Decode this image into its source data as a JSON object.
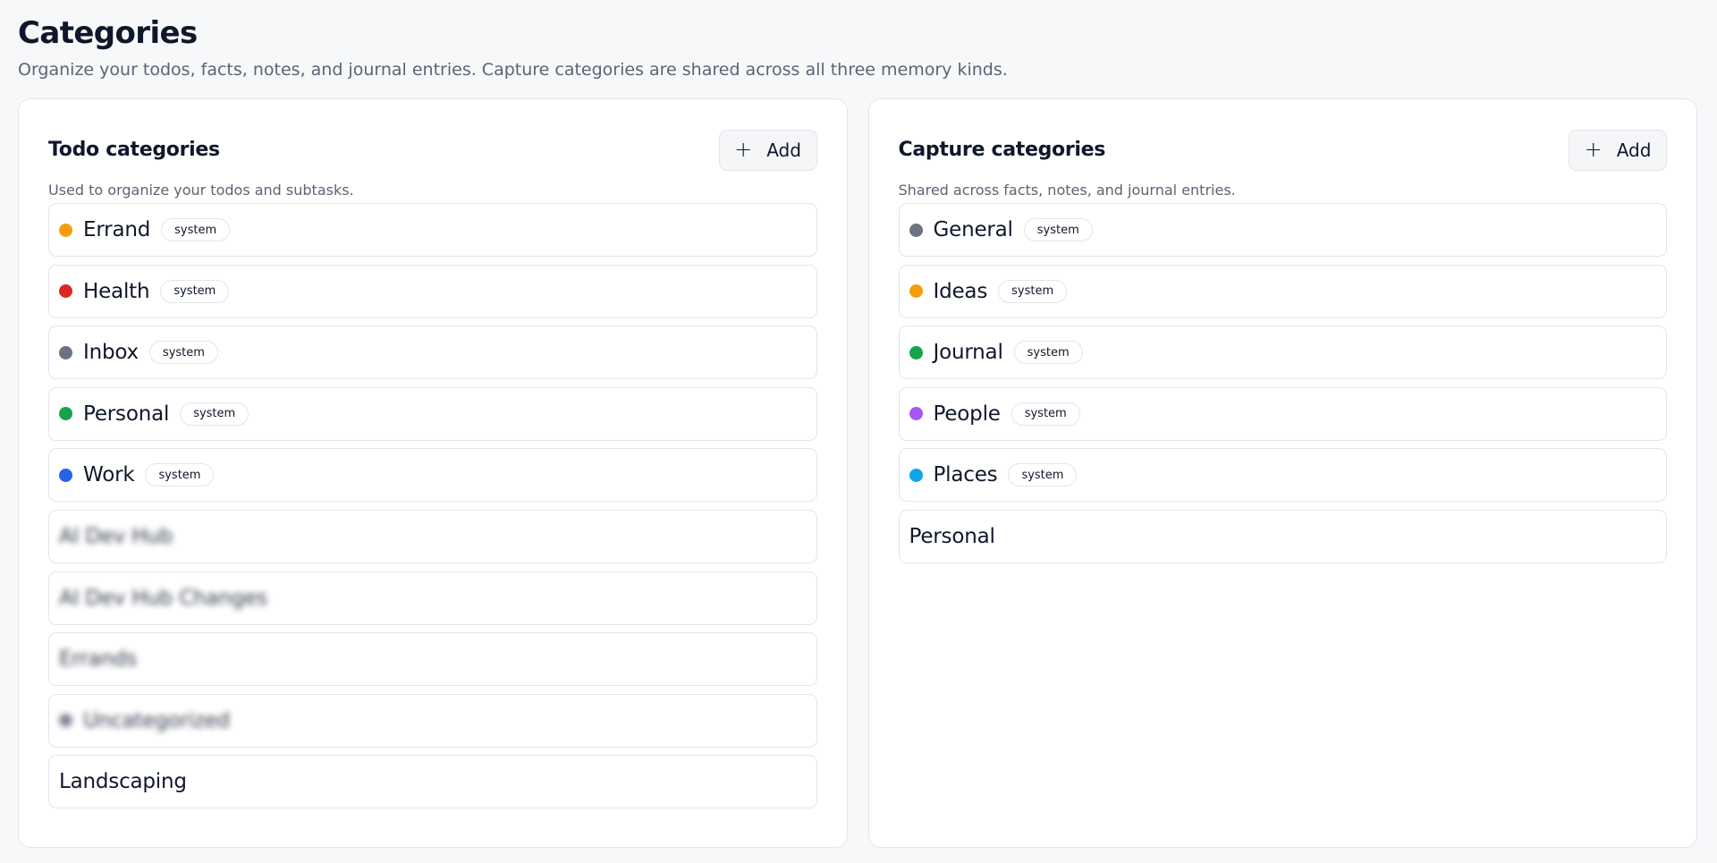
{
  "page": {
    "title": "Categories",
    "subtitle": "Organize your todos, facts, notes, and journal entries. Capture categories are shared across all three memory kinds."
  },
  "todo": {
    "title": "Todo categories",
    "description": "Used to organize your todos and subtasks.",
    "add_label": "Add",
    "items": [
      {
        "name": "Errand",
        "badge": "system",
        "color": "#f59e0b"
      },
      {
        "name": "Health",
        "badge": "system",
        "color": "#dc2626"
      },
      {
        "name": "Inbox",
        "badge": "system",
        "color": "#6b7280"
      },
      {
        "name": "Personal",
        "badge": "system",
        "color": "#16a34a"
      },
      {
        "name": "Work",
        "badge": "system",
        "color": "#2563eb"
      },
      {
        "name": "AI Dev Hub",
        "blurred": true
      },
      {
        "name": "AI Dev Hub Changes",
        "blurred": true
      },
      {
        "name": "Errands",
        "blurred": true
      },
      {
        "name": "Uncategorized",
        "blurred": true,
        "color": "#6b7280"
      },
      {
        "name": "Landscaping"
      }
    ]
  },
  "capture": {
    "title": "Capture categories",
    "description": "Shared across facts, notes, and journal entries.",
    "add_label": "Add",
    "items": [
      {
        "name": "General",
        "badge": "system",
        "color": "#6b7280"
      },
      {
        "name": "Ideas",
        "badge": "system",
        "color": "#f59e0b"
      },
      {
        "name": "Journal",
        "badge": "system",
        "color": "#16a34a"
      },
      {
        "name": "People",
        "badge": "system",
        "color": "#a855f7"
      },
      {
        "name": "Places",
        "badge": "system",
        "color": "#0ea5e9"
      },
      {
        "name": "Personal"
      }
    ]
  }
}
